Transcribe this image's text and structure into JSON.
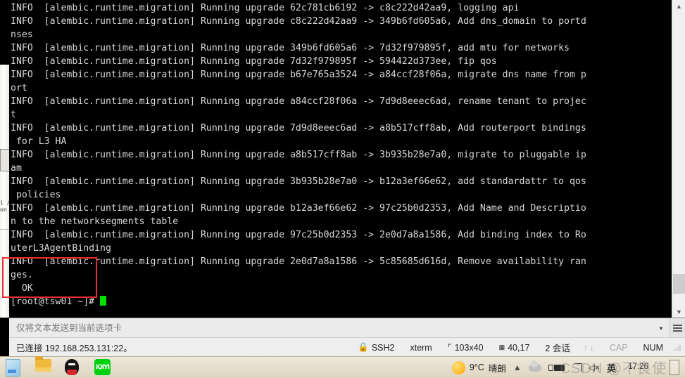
{
  "terminal": {
    "prompt": "[root@tsw01 ~]#",
    "lines": [
      "INFO  [alembic.runtime.migration] Running upgrade 62c781cb6192 -> c8c222d42aa9, logging api",
      "INFO  [alembic.runtime.migration] Running upgrade c8c222d42aa9 -> 349b6fd605a6, Add dns_domain to portd",
      "nses",
      "INFO  [alembic.runtime.migration] Running upgrade 349b6fd605a6 -> 7d32f979895f, add mtu for networks",
      "INFO  [alembic.runtime.migration] Running upgrade 7d32f979895f -> 594422d373ee, fip qos",
      "INFO  [alembic.runtime.migration] Running upgrade b67e765a3524 -> a84ccf28f06a, migrate dns name from p",
      "ort",
      "INFO  [alembic.runtime.migration] Running upgrade a84ccf28f06a -> 7d9d8eeec6ad, rename tenant to projec",
      "t",
      "INFO  [alembic.runtime.migration] Running upgrade 7d9d8eeec6ad -> a8b517cff8ab, Add routerport bindings",
      " for L3 HA",
      "INFO  [alembic.runtime.migration] Running upgrade a8b517cff8ab -> 3b935b28e7a0, migrate to pluggable ip",
      "am",
      "INFO  [alembic.runtime.migration] Running upgrade 3b935b28e7a0 -> b12a3ef66e62, add standardattr to qos",
      " policies",
      "INFO  [alembic.runtime.migration] Running upgrade b12a3ef66e62 -> 97c25b0d2353, Add Name and Descriptio",
      "n to the networksegments table",
      "INFO  [alembic.runtime.migration] Running upgrade 97c25b0d2353 -> 2e0d7a8a1586, Add binding index to Ro",
      "uterL3AgentBinding",
      "INFO  [alembic.runtime.migration] Running upgrade 2e0d7a8a1586 -> 5c85685d616d, Remove availability ran",
      "ges.",
      "  OK"
    ],
    "highlight_note": "red-annotation-box"
  },
  "sendbar": {
    "placeholder": "仅将文本发送到当前选项卡",
    "value": "",
    "dropdown_icon": "chevron-down-icon",
    "menu_icon": "hamburger-menu-icon"
  },
  "statusbar": {
    "connection": "已连接 192.168.253.131:22。",
    "protocol": "SSH2",
    "emulation": "xterm",
    "size": "103x40",
    "cursor": "40,17",
    "sessions": "2 会话",
    "cap": "CAP",
    "num": "NUM",
    "lock_icon": "lock-icon",
    "resize_icon": "resize-icon",
    "cursor_icon": "cursor-position-icon",
    "up_arrow": "↑",
    "down_arrow": "↓"
  },
  "taskbar": {
    "apps": [
      {
        "name": "notes-app-icon",
        "label": "Notes"
      },
      {
        "name": "file-explorer-icon",
        "label": "Explorer"
      },
      {
        "name": "qq-app-icon",
        "label": "QQ"
      },
      {
        "name": "iqiyi-app-icon",
        "label": "iQIYI"
      }
    ],
    "weather_temp": "9°C",
    "weather_desc": "晴朗",
    "tray": {
      "expand_icon": "chevron-up-icon",
      "cloud_icon": "cloud-icon",
      "battery_icon": "battery-plug-icon",
      "network_icon": "network-icon",
      "volume_muted": "◁×",
      "ime": "英"
    },
    "clock": "17:26",
    "show_desktop": "show-desktop-button"
  },
  "watermark": "CSDN @不良使",
  "scrollbar": {
    "up_icon": "scroll-up-icon",
    "down_icon": "scroll-down-icon"
  },
  "colors": {
    "terminal_bg": "#000000",
    "terminal_fg": "#d8d8d8",
    "cursor": "#00e000",
    "highlight": "#ec2d2d",
    "taskbar": "#e8e0d0"
  }
}
